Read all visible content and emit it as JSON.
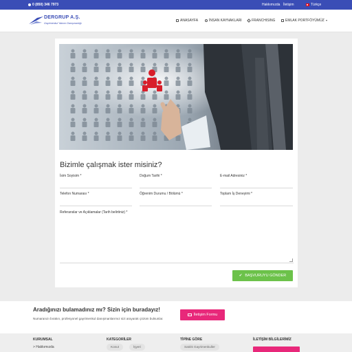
{
  "topbar": {
    "phone": "0 (850) 346 7973",
    "links": [
      "Hakkımızda",
      "İletişim"
    ],
    "language": "Türkçe",
    "color": "#3a4db6"
  },
  "header": {
    "logo": {
      "name": "DERGRUP A.Ş.",
      "tagline": "Gayrimenkul Yatırım Danışmanlığı"
    },
    "nav": [
      {
        "label": "ANASAYFA",
        "icon": "home-icon"
      },
      {
        "label": "İNSAN KAYNAKLARI",
        "icon": "people-icon"
      },
      {
        "label": "FRANCHISING",
        "icon": "franchise-icon"
      },
      {
        "label": "EMLAK PORTFÖYÜMÜZ",
        "icon": "building-icon",
        "dropdown": true
      }
    ]
  },
  "form": {
    "title": "Bizimle çalışmak ister misiniz?",
    "fields": [
      {
        "label": "İsim Soyisim *",
        "value": ""
      },
      {
        "label": "Doğum Tarihi *",
        "value": ""
      },
      {
        "label": "E-mail Adresiniz *",
        "value": ""
      },
      {
        "label": "Telefon Numarası *",
        "value": ""
      },
      {
        "label": "Öğrenim Durumu / Bölümü *",
        "value": ""
      },
      {
        "label": "Toplam İş Deneyimi *",
        "value": ""
      }
    ],
    "textarea_label": "Referanslar ve Açıklamalar (Tarih belirtiniz) *",
    "textarea_value": "",
    "submit_label": "BAŞVURUYU GÖNDER",
    "submit_color": "#6cc24a"
  },
  "cta": {
    "title": "Aradığınızı bulamadınız mı? Sizin için buradayız!",
    "description": "Numaranızı bırakın, profesyonel gayrimenkul danışmanlarımız sizi arayarak çözüm bulsunlar.",
    "button_label": "İletişim Formu",
    "button_color": "#e8287a"
  },
  "footer": {
    "columns": [
      {
        "heading": "KURUMSAL",
        "links": [
          "> Hakkımızda"
        ]
      },
      {
        "heading": "KATEGORİLER",
        "tags": [
          "Konut",
          "İşyeri"
        ]
      },
      {
        "heading": "TİPİNE GÖRE",
        "tags": [
          "Satılık Gayrimenkuller"
        ]
      },
      {
        "heading": "İLETİŞİM BİLGİLERİMİZ"
      }
    ]
  }
}
